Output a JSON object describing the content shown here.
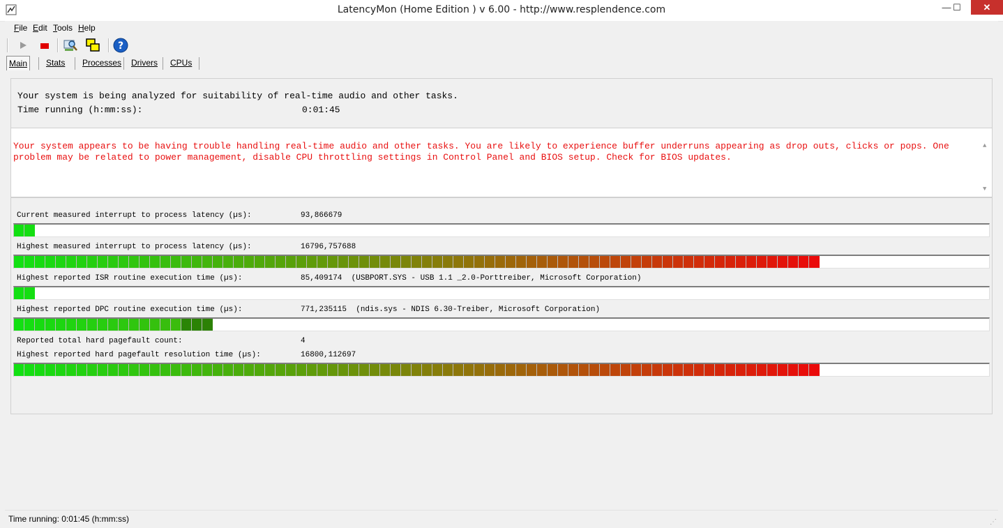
{
  "window": {
    "title": "LatencyMon  (Home Edition )  v 6.00 - http://www.resplendence.com",
    "minimize": "—",
    "maximize": "☐",
    "close": "✕"
  },
  "menu": [
    {
      "label": "File",
      "key": "F",
      "rest": "ile"
    },
    {
      "label": "Edit",
      "key": "E",
      "rest": "dit"
    },
    {
      "label": "Tools",
      "key": "T",
      "rest": "ools"
    },
    {
      "label": "Help",
      "key": "H",
      "rest": "elp"
    }
  ],
  "toolbar": {
    "icons": [
      "play-icon",
      "stop-icon",
      "search-settings-icon",
      "windows-icon",
      "help-icon"
    ],
    "colors": {
      "stop": "#e00000",
      "help": "#1a5fc4"
    }
  },
  "tabs": [
    {
      "label": "Main",
      "active": true
    },
    {
      "label": "Stats",
      "active": false
    },
    {
      "label": "Processes",
      "active": false
    },
    {
      "label": "Drivers",
      "active": false
    },
    {
      "label": "CPUs",
      "active": false
    }
  ],
  "summary": {
    "line1": "Your system is being analyzed for suitability of real-time audio and other tasks.",
    "time_label": "Time running (h:mm:ss):",
    "time_value": "0:01:45"
  },
  "message": {
    "text": "Your system appears to be having trouble handling real-time audio and other tasks. You are likely to experience buffer underruns appearing as drop outs, clicks or pops. One problem may be related to power management, disable CPU throttling settings in Control Panel and BIOS setup. Check for BIOS updates.",
    "color": "#e81010"
  },
  "metrics": {
    "current_latency": {
      "label": "Current measured interrupt to process latency (µs):",
      "value": "93,866679",
      "fill_segments": 2
    },
    "highest_latency": {
      "label": "Highest measured interrupt to process latency (µs):",
      "value": "16796,757688",
      "fill_segments": 77
    },
    "isr": {
      "label": "Highest reported ISR routine execution time (µs):",
      "value": "85,409174  (USBPORT.SYS - USB 1.1 _2.0-Porttreiber, Microsoft Corporation)",
      "fill_segments": 2
    },
    "dpc": {
      "label": "Highest reported DPC routine execution time (µs):",
      "value": "771,235115  (ndis.sys - NDIS 6.30-Treiber, Microsoft Corporation)",
      "fill_segments": 19
    },
    "pagefault_count": {
      "label": "Reported total hard pagefault count:",
      "value": "4"
    },
    "pagefault_time": {
      "label": "Highest reported hard pagefault resolution time (µs):",
      "value": "16800,112697",
      "fill_segments": 77
    }
  },
  "meter_colors": {
    "start": "#12e012",
    "end": "#ea0a0a"
  },
  "status": {
    "text": "Time running: 0:01:45  (h:mm:ss)"
  }
}
